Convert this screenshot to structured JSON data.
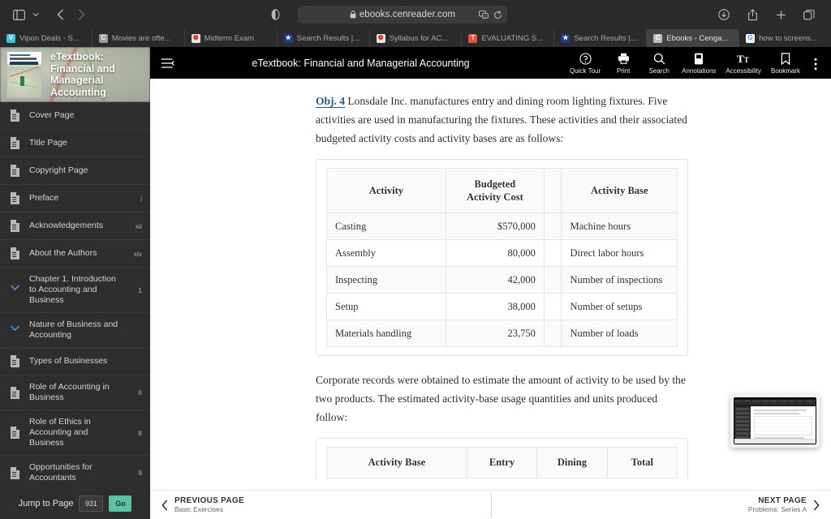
{
  "browser": {
    "url": "ebooks.cenreader.com",
    "icons": {
      "sidebar": "sidebar-toggle-icon",
      "chevron_down": "chevron-down-icon",
      "back": "back-icon",
      "forward": "forward-icon",
      "privacy": "privacy-reader-icon",
      "lock": "lock-icon",
      "extension": "extension-icon",
      "reload": "reload-icon",
      "download": "download-icon",
      "share": "share-icon",
      "new_tab": "new-tab-icon",
      "tab_overview": "tab-overview-icon"
    },
    "tabs": [
      {
        "title": "Vipon Deals - S...",
        "favicon_letter": "V",
        "favicon_color": "#3ec6d8",
        "active": false
      },
      {
        "title": "Movies are ofte...",
        "favicon_letter": "C",
        "favicon_color": "#9b9b9b",
        "active": false
      },
      {
        "title": "Midterm Exam",
        "favicon_letter": "❁",
        "favicon_color": "#e8e8e8",
        "active": false
      },
      {
        "title": "Search Results |...",
        "favicon_letter": "★",
        "favicon_color": "#1f3c88",
        "active": false
      },
      {
        "title": "Syllabus for AC...",
        "favicon_letter": "❁",
        "favicon_color": "#e8e8e8",
        "active": false
      },
      {
        "title": "EVALUATING S...",
        "favicon_letter": "T",
        "favicon_color": "#e8503a",
        "active": false
      },
      {
        "title": "Search Results |...",
        "favicon_letter": "★",
        "favicon_color": "#1f3c88",
        "active": false
      },
      {
        "title": "Ebooks - Cenga...",
        "favicon_letter": "C",
        "favicon_color": "#9b9b9b",
        "active": true
      },
      {
        "title": "how to screens...",
        "favicon_letter": "G",
        "favicon_color": "#ffffff",
        "active": false
      }
    ]
  },
  "sidebar": {
    "book_title": "eTextbook: Financial and Managerial Accounting",
    "toc": [
      {
        "label": "Cover Page",
        "page": "",
        "icon": "page-icon"
      },
      {
        "label": "Title Page",
        "page": "",
        "icon": "page-icon"
      },
      {
        "label": "Copyright Page",
        "page": "",
        "icon": "page-icon"
      },
      {
        "label": "Preface",
        "page": "i",
        "icon": "page-icon"
      },
      {
        "label": "Acknowledgements",
        "page": "xii",
        "icon": "page-icon"
      },
      {
        "label": "About the Authors",
        "page": "xiv",
        "icon": "page-icon"
      },
      {
        "label": "Chapter 1. Introduction to Accounting and Business",
        "page": "1",
        "icon": "chevron-down-icon"
      },
      {
        "label": "Nature of Business and Accounting",
        "page": "",
        "icon": "chevron-down-icon"
      },
      {
        "label": "Types of Businesses",
        "page": "",
        "icon": "page-icon"
      },
      {
        "label": "Role of Accounting in Business",
        "page": "6",
        "icon": "page-icon"
      },
      {
        "label": "Role of Ethics in Accounting and Business",
        "page": "8",
        "icon": "page-icon"
      },
      {
        "label": "Opportunities for Accountants",
        "page": "9",
        "icon": "page-icon"
      }
    ],
    "jump": {
      "label": "Jump to Page",
      "value": "931",
      "go_label": "Go"
    }
  },
  "reader_header": {
    "title": "eTextbook: Financial and Managerial Accounting",
    "menu_icon": "hamburger-collapse-icon",
    "actions": [
      {
        "label": "Quick Tour",
        "icon": "question-circle-icon"
      },
      {
        "label": "Print",
        "icon": "printer-icon"
      },
      {
        "label": "Search",
        "icon": "search-icon"
      },
      {
        "label": "Annotations",
        "icon": "annotations-icon"
      },
      {
        "label": "Accessibility",
        "icon": "text-size-icon"
      },
      {
        "label": "Bookmark",
        "icon": "bookmark-icon"
      }
    ],
    "more_icon": "more-vertical-icon"
  },
  "content": {
    "obj_tag": "Obj. 4",
    "paragraph1": "Lonsdale Inc. manufactures entry and dining room lighting fixtures. Five activities are used in manufacturing the fixtures. These activities and their associated budgeted activity costs and activity bases are as follows:",
    "paragraph2": "Corporate records were obtained to estimate the amount of activity to be used by the two products. The estimated activity-base usage quantities and units produced follow:",
    "table1": {
      "headers": [
        "Activity",
        "Budgeted Activity Cost",
        "",
        "Activity Base"
      ],
      "header_cost_line1": "Budgeted",
      "header_cost_line2": "Activity Cost",
      "rows": [
        {
          "activity": "Casting",
          "cost": "$570,000",
          "base": "Machine hours"
        },
        {
          "activity": "Assembly",
          "cost": "80,000",
          "base": "Direct labor hours"
        },
        {
          "activity": "Inspecting",
          "cost": "42,000",
          "base": "Number of inspections"
        },
        {
          "activity": "Setup",
          "cost": "38,000",
          "base": "Number of setups"
        },
        {
          "activity": "Materials handling",
          "cost": "23,750",
          "base": "Number of loads"
        }
      ]
    },
    "table2": {
      "headers": [
        "Activity Base",
        "Entry",
        "Dining",
        "Total"
      ]
    }
  },
  "footer": {
    "previous": {
      "main": "PREVIOUS PAGE",
      "sub": "Basic Exercises",
      "icon": "chevron-left-icon"
    },
    "next": {
      "main": "NEXT PAGE",
      "sub": "Problems: Series A",
      "icon": "chevron-right-icon"
    }
  },
  "pip": {
    "name": "screen-share-preview"
  }
}
